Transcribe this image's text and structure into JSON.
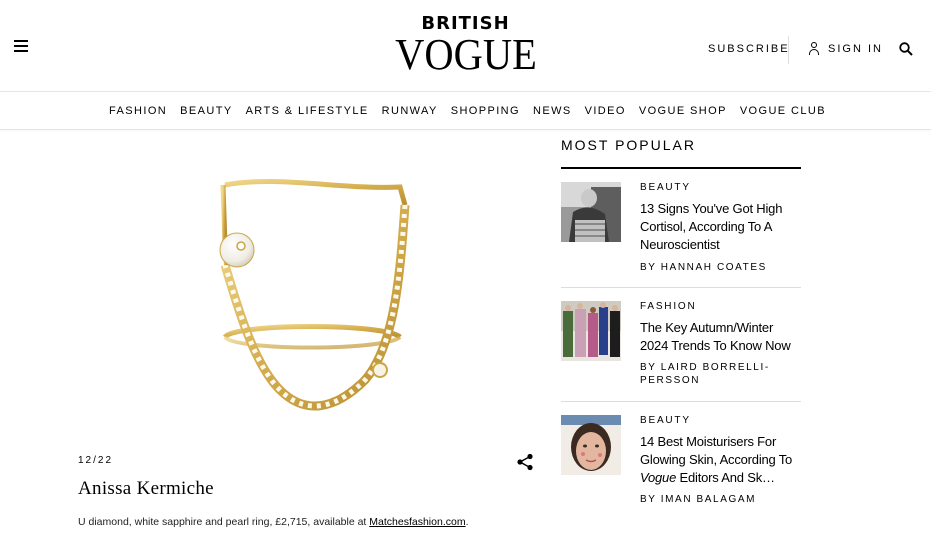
{
  "header": {
    "logo_top": "BRITISH",
    "logo_main": "VOGUE",
    "subscribe": "SUBSCRIBE",
    "sign_in": "SIGN IN"
  },
  "nav": [
    "FASHION",
    "BEAUTY",
    "ARTS & LIFESTYLE",
    "RUNWAY",
    "SHOPPING",
    "NEWS",
    "VIDEO",
    "VOGUE SHOP",
    "VOGUE CLUB"
  ],
  "gallery": {
    "counter": "12/22",
    "designer": "Anissa Kermiche",
    "caption_text": "U diamond, white sapphire and pearl ring, £2,715, available at ",
    "caption_link": "Matchesfashion.com",
    "caption_end": "."
  },
  "most_popular": {
    "title": "MOST POPULAR",
    "items": [
      {
        "category": "BEAUTY",
        "headline": "13 Signs You've Got High Cortisol, According To A Neuroscientist",
        "byline": "BY HANNAH COATES"
      },
      {
        "category": "FASHION",
        "headline": "The Key Autumn/Winter 2024 Trends To Know Now",
        "byline": "BY LAIRD BORRELLI-PERSSON"
      },
      {
        "category": "BEAUTY",
        "headline_pre": "14 Best Moisturisers For Glowing Skin, According To ",
        "headline_em": "Vogue",
        "headline_post": " Editors And Sk…",
        "byline": "BY IMAN BALAGAM"
      }
    ]
  },
  "colors": {
    "gold": "#d9b75a",
    "text": "#000000",
    "divider": "#dddddd"
  }
}
